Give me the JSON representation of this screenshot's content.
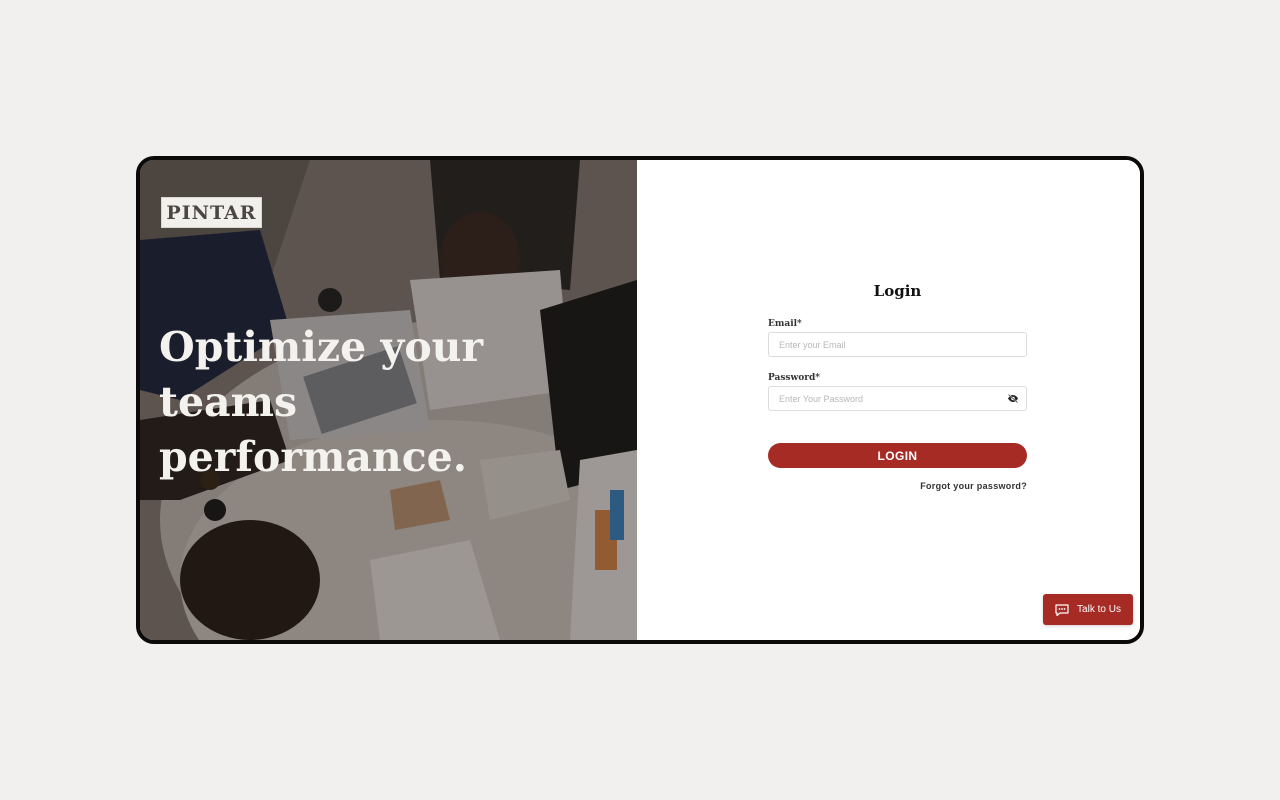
{
  "brand": {
    "logo_text": "PINTAR"
  },
  "hero": {
    "tagline": "Optimize your teams performance."
  },
  "login": {
    "title": "Login",
    "email_label": "Email*",
    "email_placeholder": "Enter your Email",
    "password_label": "Password*",
    "password_placeholder": "Enter Your Password",
    "submit_label": "LOGIN",
    "forgot_label": "Forgot your password?"
  },
  "chat_widget": {
    "label": "Talk to Us",
    "icon": "chat-icon"
  },
  "colors": {
    "accent": "#a62b25",
    "background": "#f1f0ee"
  }
}
